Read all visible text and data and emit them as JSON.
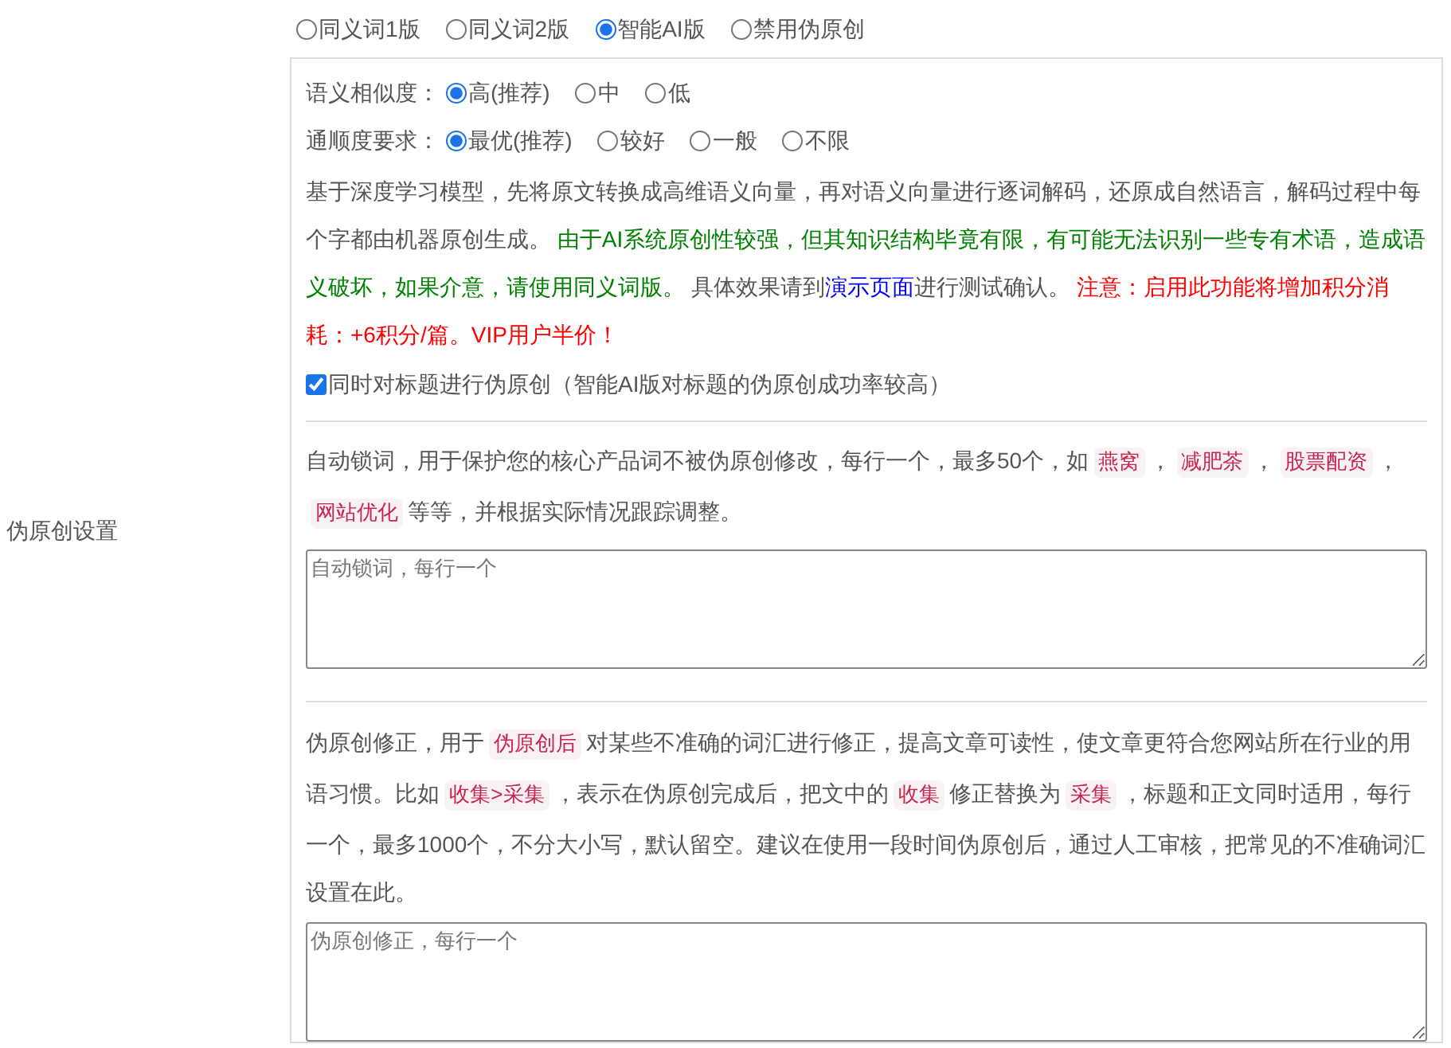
{
  "label": "伪原创设置",
  "modes": [
    {
      "label": "同义词1版",
      "selected": false
    },
    {
      "label": "同义词2版",
      "selected": false
    },
    {
      "label": "智能AI版",
      "selected": true
    },
    {
      "label": "禁用伪原创",
      "selected": false
    }
  ],
  "settings": [
    {
      "label": "语义相似度：",
      "options": [
        {
          "label": "高(推荐)",
          "selected": true
        },
        {
          "label": "中",
          "selected": false
        },
        {
          "label": "低",
          "selected": false
        }
      ]
    },
    {
      "label": "通顺度要求：",
      "options": [
        {
          "label": "最优(推荐)",
          "selected": true
        },
        {
          "label": "较好",
          "selected": false
        },
        {
          "label": "一般",
          "selected": false
        },
        {
          "label": "不限",
          "selected": false
        }
      ]
    }
  ],
  "description": [
    {
      "kind": "plain",
      "text": "基于深度学习模型，先将原文转换成高维语义向量，再对语义向量进行逐词解码，还原成自然语言，解码过程中每个字都由机器原创生成。 "
    },
    {
      "kind": "green",
      "text": "由于AI系统原创性较强，但其知识结构毕竟有限，有可能无法识别一些专有术语，造成语义破坏，如果介意，请使用同义词版。"
    },
    {
      "kind": "plain",
      "text": " 具体效果请到"
    },
    {
      "kind": "link",
      "text": "演示页面"
    },
    {
      "kind": "plain",
      "text": "进行测试确认。 "
    },
    {
      "kind": "red",
      "text": "注意：启用此功能将增加积分消耗：+6积分/篇。VIP用户半价！"
    }
  ],
  "title_option": {
    "label": "同时对标题进行伪原创（智能AI版对标题的伪原创成功率较高）",
    "checked": true
  },
  "lock_words": {
    "description": [
      {
        "kind": "plain",
        "text": "自动锁词，用于保护您的核心产品词不被伪原创修改，每行一个，最多50个，如"
      },
      {
        "kind": "tag",
        "text": "燕窝"
      },
      {
        "kind": "plain",
        "text": "，"
      },
      {
        "kind": "tag",
        "text": "减肥茶"
      },
      {
        "kind": "plain",
        "text": "，"
      },
      {
        "kind": "tag",
        "text": "股票配资"
      },
      {
        "kind": "plain",
        "text": "，"
      },
      {
        "kind": "tag",
        "text": "网站优化"
      },
      {
        "kind": "plain",
        "text": "等等，并根据实际情况跟踪调整。"
      }
    ],
    "placeholder": "自动锁词，每行一个"
  },
  "correction": {
    "description": [
      {
        "kind": "plain",
        "text": "伪原创修正，用于"
      },
      {
        "kind": "tag",
        "text": "伪原创后"
      },
      {
        "kind": "plain",
        "text": "对某些不准确的词汇进行修正，提高文章可读性，使文章更符合您网站所在行业的用语习惯。比如"
      },
      {
        "kind": "tag",
        "text": "收集>采集"
      },
      {
        "kind": "plain",
        "text": "，表示在伪原创完成后，把文中的"
      },
      {
        "kind": "tag",
        "text": "收集"
      },
      {
        "kind": "plain",
        "text": "修正替换为"
      },
      {
        "kind": "tag",
        "text": "采集"
      },
      {
        "kind": "plain",
        "text": "，标题和正文同时适用，每行一个，最多1000个，不分大小写，默认留空。建议在使用一段时间伪原创后，通过人工审核，把常见的不准确词汇设置在此。"
      }
    ],
    "placeholder": "伪原创修正，每行一个"
  }
}
